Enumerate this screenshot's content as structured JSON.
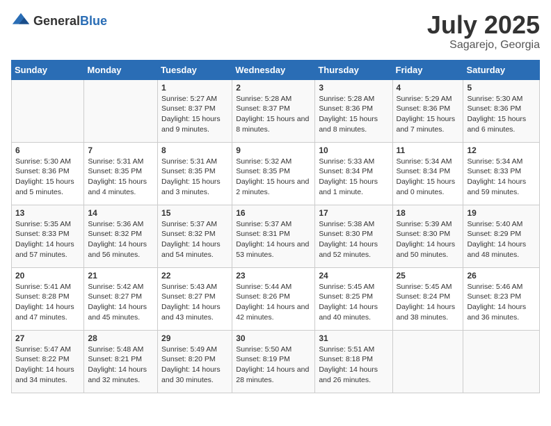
{
  "logo": {
    "general": "General",
    "blue": "Blue"
  },
  "title": "July 2025",
  "subtitle": "Sagarejo, Georgia",
  "days_of_week": [
    "Sunday",
    "Monday",
    "Tuesday",
    "Wednesday",
    "Thursday",
    "Friday",
    "Saturday"
  ],
  "weeks": [
    [
      {
        "day": "",
        "info": ""
      },
      {
        "day": "",
        "info": ""
      },
      {
        "day": "1",
        "info": "Sunrise: 5:27 AM\nSunset: 8:37 PM\nDaylight: 15 hours and 9 minutes."
      },
      {
        "day": "2",
        "info": "Sunrise: 5:28 AM\nSunset: 8:37 PM\nDaylight: 15 hours and 8 minutes."
      },
      {
        "day": "3",
        "info": "Sunrise: 5:28 AM\nSunset: 8:36 PM\nDaylight: 15 hours and 8 minutes."
      },
      {
        "day": "4",
        "info": "Sunrise: 5:29 AM\nSunset: 8:36 PM\nDaylight: 15 hours and 7 minutes."
      },
      {
        "day": "5",
        "info": "Sunrise: 5:30 AM\nSunset: 8:36 PM\nDaylight: 15 hours and 6 minutes."
      }
    ],
    [
      {
        "day": "6",
        "info": "Sunrise: 5:30 AM\nSunset: 8:36 PM\nDaylight: 15 hours and 5 minutes."
      },
      {
        "day": "7",
        "info": "Sunrise: 5:31 AM\nSunset: 8:35 PM\nDaylight: 15 hours and 4 minutes."
      },
      {
        "day": "8",
        "info": "Sunrise: 5:31 AM\nSunset: 8:35 PM\nDaylight: 15 hours and 3 minutes."
      },
      {
        "day": "9",
        "info": "Sunrise: 5:32 AM\nSunset: 8:35 PM\nDaylight: 15 hours and 2 minutes."
      },
      {
        "day": "10",
        "info": "Sunrise: 5:33 AM\nSunset: 8:34 PM\nDaylight: 15 hours and 1 minute."
      },
      {
        "day": "11",
        "info": "Sunrise: 5:34 AM\nSunset: 8:34 PM\nDaylight: 15 hours and 0 minutes."
      },
      {
        "day": "12",
        "info": "Sunrise: 5:34 AM\nSunset: 8:33 PM\nDaylight: 14 hours and 59 minutes."
      }
    ],
    [
      {
        "day": "13",
        "info": "Sunrise: 5:35 AM\nSunset: 8:33 PM\nDaylight: 14 hours and 57 minutes."
      },
      {
        "day": "14",
        "info": "Sunrise: 5:36 AM\nSunset: 8:32 PM\nDaylight: 14 hours and 56 minutes."
      },
      {
        "day": "15",
        "info": "Sunrise: 5:37 AM\nSunset: 8:32 PM\nDaylight: 14 hours and 54 minutes."
      },
      {
        "day": "16",
        "info": "Sunrise: 5:37 AM\nSunset: 8:31 PM\nDaylight: 14 hours and 53 minutes."
      },
      {
        "day": "17",
        "info": "Sunrise: 5:38 AM\nSunset: 8:30 PM\nDaylight: 14 hours and 52 minutes."
      },
      {
        "day": "18",
        "info": "Sunrise: 5:39 AM\nSunset: 8:30 PM\nDaylight: 14 hours and 50 minutes."
      },
      {
        "day": "19",
        "info": "Sunrise: 5:40 AM\nSunset: 8:29 PM\nDaylight: 14 hours and 48 minutes."
      }
    ],
    [
      {
        "day": "20",
        "info": "Sunrise: 5:41 AM\nSunset: 8:28 PM\nDaylight: 14 hours and 47 minutes."
      },
      {
        "day": "21",
        "info": "Sunrise: 5:42 AM\nSunset: 8:27 PM\nDaylight: 14 hours and 45 minutes."
      },
      {
        "day": "22",
        "info": "Sunrise: 5:43 AM\nSunset: 8:27 PM\nDaylight: 14 hours and 43 minutes."
      },
      {
        "day": "23",
        "info": "Sunrise: 5:44 AM\nSunset: 8:26 PM\nDaylight: 14 hours and 42 minutes."
      },
      {
        "day": "24",
        "info": "Sunrise: 5:45 AM\nSunset: 8:25 PM\nDaylight: 14 hours and 40 minutes."
      },
      {
        "day": "25",
        "info": "Sunrise: 5:45 AM\nSunset: 8:24 PM\nDaylight: 14 hours and 38 minutes."
      },
      {
        "day": "26",
        "info": "Sunrise: 5:46 AM\nSunset: 8:23 PM\nDaylight: 14 hours and 36 minutes."
      }
    ],
    [
      {
        "day": "27",
        "info": "Sunrise: 5:47 AM\nSunset: 8:22 PM\nDaylight: 14 hours and 34 minutes."
      },
      {
        "day": "28",
        "info": "Sunrise: 5:48 AM\nSunset: 8:21 PM\nDaylight: 14 hours and 32 minutes."
      },
      {
        "day": "29",
        "info": "Sunrise: 5:49 AM\nSunset: 8:20 PM\nDaylight: 14 hours and 30 minutes."
      },
      {
        "day": "30",
        "info": "Sunrise: 5:50 AM\nSunset: 8:19 PM\nDaylight: 14 hours and 28 minutes."
      },
      {
        "day": "31",
        "info": "Sunrise: 5:51 AM\nSunset: 8:18 PM\nDaylight: 14 hours and 26 minutes."
      },
      {
        "day": "",
        "info": ""
      },
      {
        "day": "",
        "info": ""
      }
    ]
  ]
}
